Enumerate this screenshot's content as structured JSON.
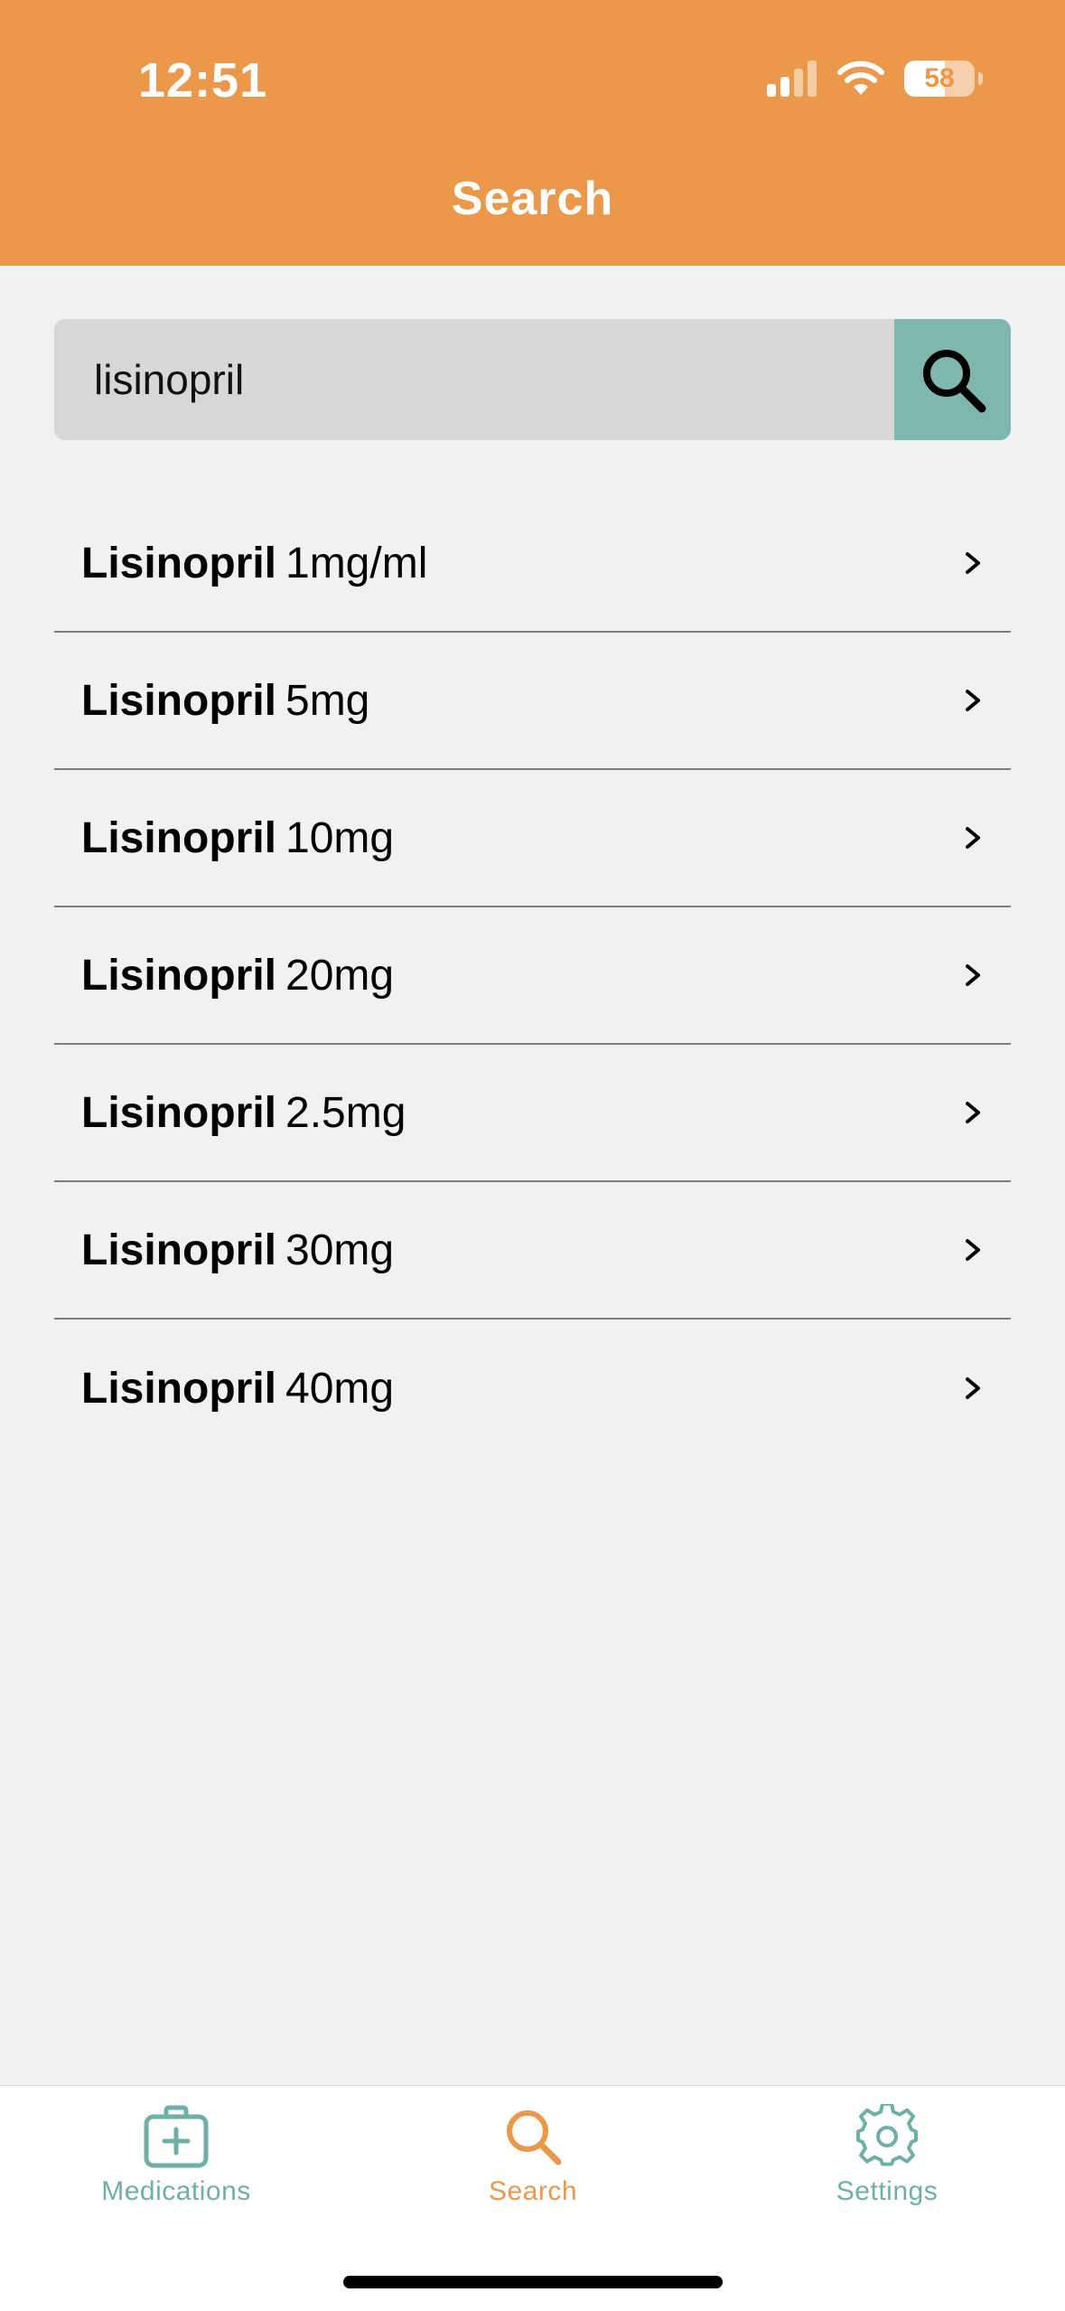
{
  "status_bar": {
    "time": "12:51",
    "battery_percent": "58",
    "battery_level": 0.58
  },
  "header": {
    "title": "Search"
  },
  "search": {
    "value": "lisinopril"
  },
  "results": [
    {
      "name": "Lisinopril",
      "dose": "1mg/ml"
    },
    {
      "name": "Lisinopril",
      "dose": "5mg"
    },
    {
      "name": "Lisinopril",
      "dose": "10mg"
    },
    {
      "name": "Lisinopril",
      "dose": "20mg"
    },
    {
      "name": "Lisinopril",
      "dose": "2.5mg"
    },
    {
      "name": "Lisinopril",
      "dose": "30mg"
    },
    {
      "name": "Lisinopril",
      "dose": "40mg"
    }
  ],
  "tabs": [
    {
      "label": "Medications",
      "icon": "medical-kit-icon"
    },
    {
      "label": "Search",
      "icon": "search-icon",
      "active": true
    },
    {
      "label": "Settings",
      "icon": "gear-icon"
    }
  ],
  "colors": {
    "accent": "#ec984a",
    "teal": "#7eb7ae",
    "background": "#f1f1f1"
  }
}
